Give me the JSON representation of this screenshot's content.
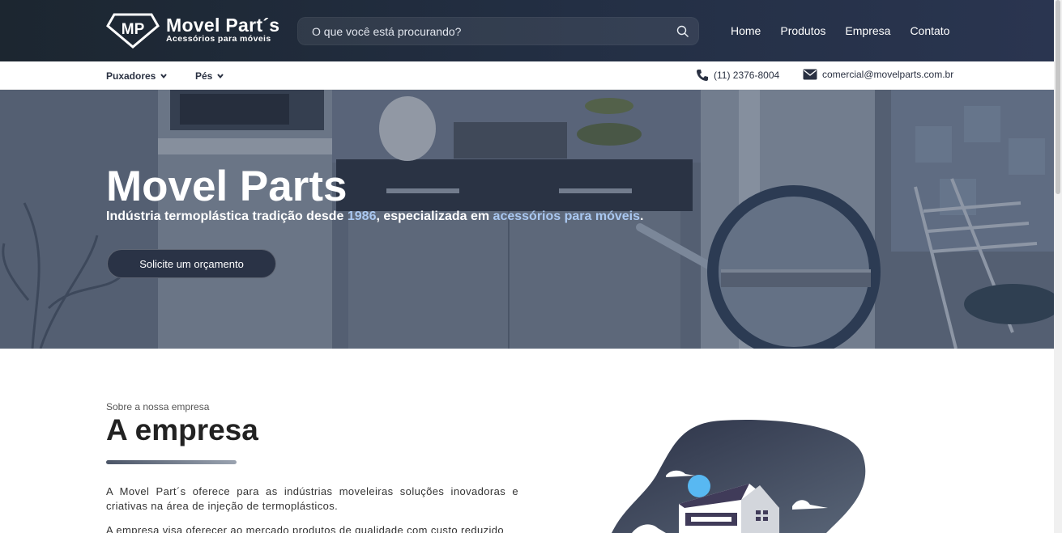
{
  "header": {
    "logo_badge": "MP",
    "logo_name": "Movel Part´s",
    "logo_tagline": "Acessórios para móveis",
    "search_placeholder": "O que você está procurando?",
    "nav": [
      "Home",
      "Produtos",
      "Empresa",
      "Contato"
    ]
  },
  "subnav": {
    "dropdowns": [
      "Puxadores",
      "Pés"
    ],
    "phone": "(11) 2376-8004",
    "email": "comercial@movelparts.com.br"
  },
  "hero": {
    "title": "Movel Parts",
    "subtitle_part1": "Indústria termoplástica tradição desde ",
    "subtitle_year": "1986",
    "subtitle_part2": ", especializada em ",
    "subtitle_highlight": "acessórios para móveis",
    "subtitle_end": ".",
    "cta_label": "Solicite um orçamento"
  },
  "about": {
    "kicker": "Sobre a nossa empresa",
    "title": "A empresa",
    "paragraph1": "A Movel Part´s oferece para as indústrias moveleiras soluções inovadoras e criativas na área de injeção de termoplásticos.",
    "paragraph2": "A empresa visa oferecer ao mercado produtos de qualidade com custo reduzido"
  },
  "colors": {
    "header_bg": "#232f44",
    "accent_highlight": "#a9c7f0",
    "cta_bg": "#2a3346"
  }
}
